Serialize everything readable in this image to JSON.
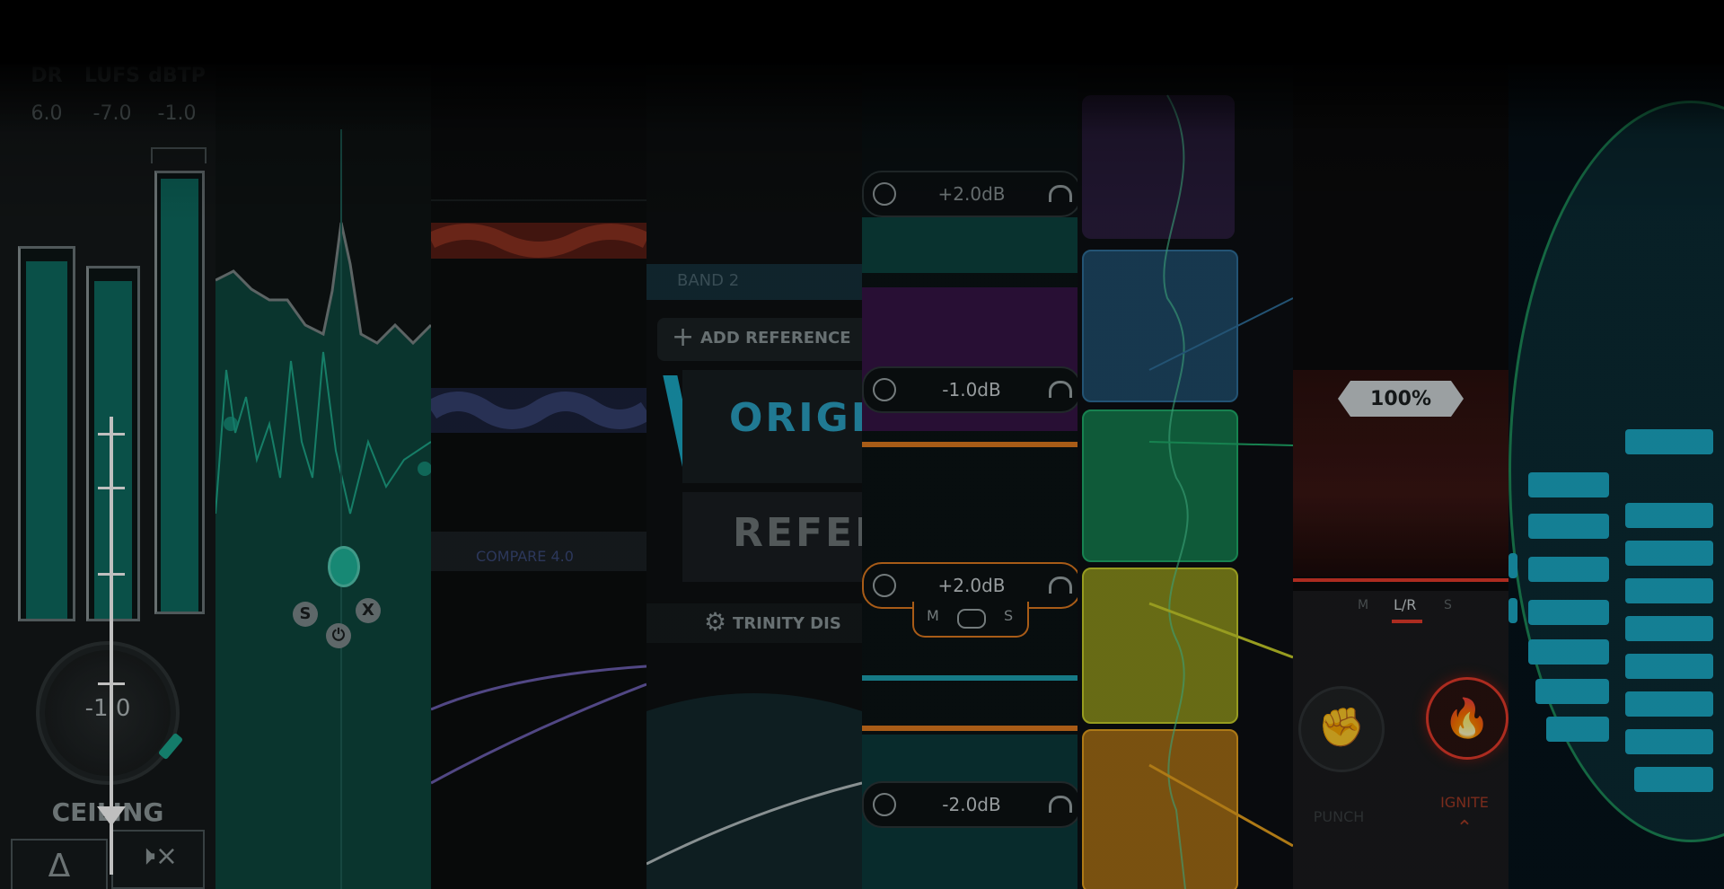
{
  "meters": {
    "labels": [
      "DR",
      "LUFS",
      "dBTP"
    ],
    "values": [
      "6.0",
      "-7.0",
      "-1.0"
    ],
    "knob_value": "-1.0",
    "ceiling_label": "CEILING",
    "mute_icon": "speaker-mute-icon",
    "delta_icon": "delta-icon"
  },
  "eq": {
    "solo_label": "S",
    "close_label": "X",
    "power_icon": "power-icon"
  },
  "waveform": {
    "compare_label": "COMPARE 4.0"
  },
  "reference": {
    "band_label": "BAND 2",
    "add_reference_label": "ADD REFERENCE",
    "original_label": "ORIGIN",
    "reference_label": "REFERE",
    "trinity_label": "TRINITY DIS"
  },
  "bands": {
    "gains": [
      "+2.0dB",
      "-1.0dB",
      "+2.0dB",
      "-2.0dB"
    ],
    "mode_m": "M",
    "mode_s": "S",
    "colors": [
      "#0e6b63",
      "#5a1670",
      "#e07a1f",
      "#1da3b3"
    ]
  },
  "color_bands": {
    "colors": [
      "#4b2f6e",
      "#2f6f9a",
      "#1fae6b",
      "#c9d02a",
      "#e8a21d"
    ]
  },
  "ignite": {
    "amount": "100%",
    "modes": [
      "M",
      "L/R",
      "S"
    ],
    "punch_label": "PUNCH",
    "ignite_label": "IGNITE",
    "punch_icon": "fist-icon",
    "ignite_icon": "flame-icon"
  },
  "accent_colors": {
    "teal": "#0d6b60",
    "cyan": "#1aa9c6",
    "orange": "#e07a1f",
    "red": "#e53a2a"
  }
}
